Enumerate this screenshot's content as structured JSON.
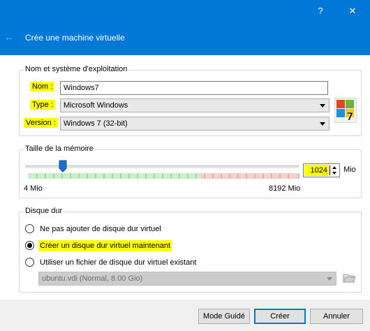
{
  "titlebar": {
    "help_label": "?",
    "close_label": "✕"
  },
  "header": {
    "back_icon": "arrow-left-icon",
    "title": "Crée une machine virtuelle"
  },
  "name_os": {
    "legend": "Nom et système d'exploitation",
    "name_label": "Nom :",
    "name_value": "Windows7",
    "type_label": "Type :",
    "type_value": "Microsoft Windows",
    "version_label": "Version :",
    "version_value": "Windows 7 (32-bit)",
    "os_icon": "windows-7-icon"
  },
  "memory": {
    "legend": "Taille de la mémoire",
    "min_label": "4 Mio",
    "max_label": "8192 Mio",
    "value": "1024",
    "unit": "Mio",
    "slider_fraction": 0.125
  },
  "disk": {
    "legend": "Disque dur",
    "options": [
      {
        "label": "Ne pas ajouter de disque dur virtuel",
        "checked": false
      },
      {
        "label": "Créer un disque dur virtuel maintenant",
        "checked": true
      },
      {
        "label": "Utiliser un fichier de disque dur virtuel existant",
        "checked": false
      }
    ],
    "file_value": "ubuntu.vdi (Normal, 8.00 Gio)",
    "folder_icon": "folder-open-icon"
  },
  "buttons": {
    "expert": "Mode Guidé",
    "create": "Créer",
    "cancel": "Annuler"
  },
  "colors": {
    "accent": "#0078d7",
    "highlight": "#ffff00"
  }
}
